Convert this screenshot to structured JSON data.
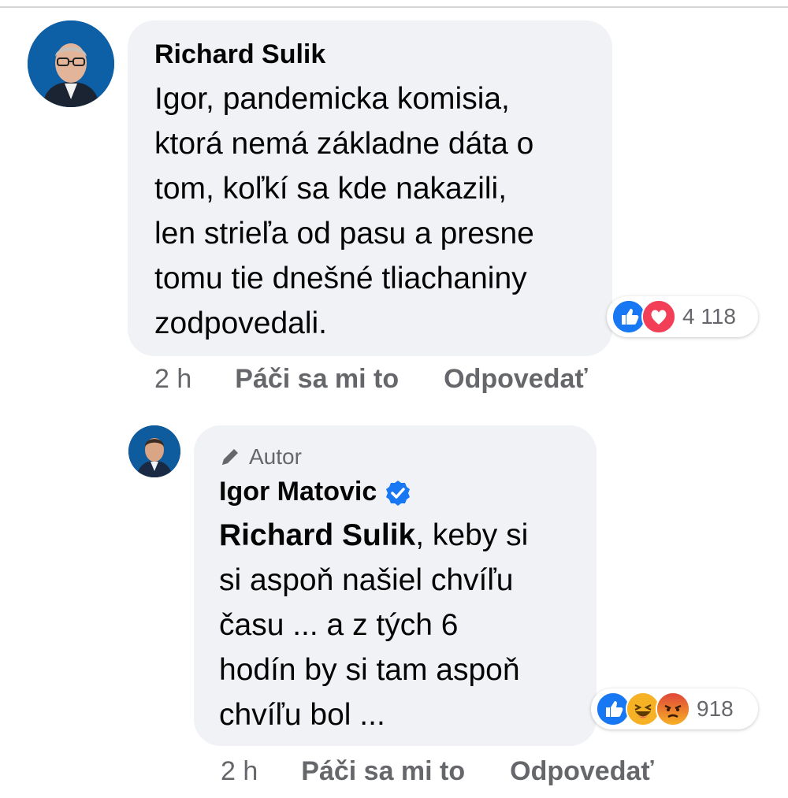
{
  "comments": [
    {
      "author": "Richard Sulik",
      "text_lines": [
        "Igor, pandemicka komisia,",
        "ktorá nemá základne dáta o",
        "tom, koľkí sa kde nakazili,",
        "len strieľa od pasu a presne",
        "tomu tie dnešné tliachaniny",
        "zodpovedali."
      ],
      "reactions": {
        "icons": [
          "like-icon",
          "love-icon"
        ],
        "count": "4 118"
      },
      "time": "2 h",
      "like_label": "Páči sa mi to",
      "reply_label": "Odpovedať"
    },
    {
      "author_tag": "Autor",
      "author": "Igor Matovic",
      "verified": true,
      "mention": "Richard Sulik",
      "text_first_rest": ", keby si",
      "text_lines": [
        "si aspoň našiel chvíľu",
        "času ... a z tých 6",
        "hodín by si tam aspoň",
        "chvíľu bol ..."
      ],
      "reactions": {
        "icons": [
          "like-icon",
          "haha-icon",
          "angry-icon"
        ],
        "count": "918"
      },
      "time": "2 h",
      "like_label": "Páči sa mi to",
      "reply_label": "Odpovedať"
    }
  ],
  "colors": {
    "bubble": "#f0f2f5",
    "secondary_text": "#65676b",
    "like_blue": "#1877f2",
    "love_red": "#f33e58",
    "haha_yellow": "#f7b125",
    "angry_orange": "#e9710f"
  }
}
